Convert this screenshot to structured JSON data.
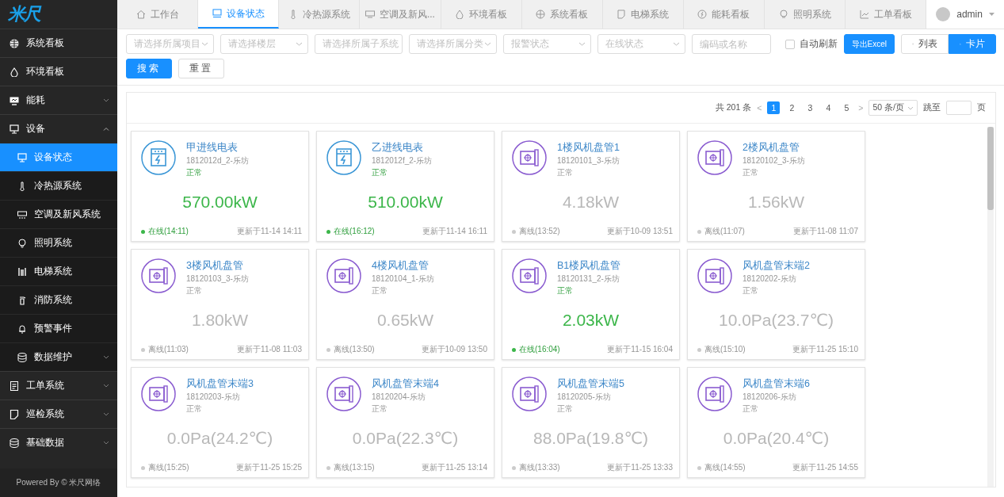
{
  "logo": "米尺",
  "sidebar": {
    "items": [
      {
        "label": "系统看板",
        "kind": "link",
        "selected": false
      },
      {
        "label": "环境看板",
        "kind": "link",
        "selected": false
      },
      {
        "label": "能耗",
        "kind": "group",
        "expanded": false
      },
      {
        "label": "设备",
        "kind": "group",
        "expanded": true,
        "children": [
          {
            "label": "设备状态",
            "kind": "link",
            "selected": true
          },
          {
            "label": "冷热源系统",
            "kind": "link",
            "selected": false
          },
          {
            "label": "空调及新风系统",
            "kind": "link",
            "selected": false
          },
          {
            "label": "照明系统",
            "kind": "link",
            "selected": false
          },
          {
            "label": "电梯系统",
            "kind": "link",
            "selected": false
          },
          {
            "label": "消防系统",
            "kind": "link",
            "selected": false
          },
          {
            "label": "预警事件",
            "kind": "link",
            "selected": false
          },
          {
            "label": "数据维护",
            "kind": "group",
            "expanded": false
          }
        ]
      },
      {
        "label": "工单系统",
        "kind": "group",
        "expanded": false
      },
      {
        "label": "巡检系统",
        "kind": "group",
        "expanded": false
      },
      {
        "label": "基础数据",
        "kind": "group",
        "expanded": false
      }
    ],
    "footer": "Powered By © 米尺网络"
  },
  "tabs": [
    {
      "label": "工作台",
      "selected": false
    },
    {
      "label": "设备状态",
      "selected": true
    },
    {
      "label": "冷热源系统",
      "selected": false
    },
    {
      "label": "空调及新风...",
      "selected": false
    },
    {
      "label": "环境看板",
      "selected": false
    },
    {
      "label": "系统看板",
      "selected": false
    },
    {
      "label": "电梯系统",
      "selected": false
    },
    {
      "label": "能耗看板",
      "selected": false
    },
    {
      "label": "照明系统",
      "selected": false
    },
    {
      "label": "工单看板",
      "selected": false
    }
  ],
  "user": {
    "name": "admin"
  },
  "filters": {
    "selects": [
      {
        "placeholder": "请选择所属项目"
      },
      {
        "placeholder": "请选择楼层"
      },
      {
        "placeholder": "请选择所属子系统"
      },
      {
        "placeholder": "请选择所属分类"
      },
      {
        "placeholder": "报警状态"
      },
      {
        "placeholder": "在线状态"
      }
    ],
    "search": {
      "placeholder": "编码或名称"
    },
    "auto_refresh": {
      "label": "自动刷新",
      "checked": false
    },
    "export": "导出Excel",
    "views": [
      {
        "label": "列表",
        "selected": false
      },
      {
        "label": "卡片",
        "selected": true
      }
    ],
    "actions": [
      {
        "label": "搜索",
        "kind": "primary"
      },
      {
        "label": "重置",
        "kind": "default"
      }
    ]
  },
  "pagination": {
    "total": "共 201 条",
    "prev": "<",
    "next": ">",
    "pages": [
      {
        "label": "1",
        "selected": true
      },
      {
        "label": "2",
        "selected": false
      },
      {
        "label": "3",
        "selected": false
      },
      {
        "label": "4",
        "selected": false
      },
      {
        "label": "5",
        "selected": false
      }
    ],
    "page_size": "50 条/页",
    "jump_label": "跳至",
    "page_suffix": "页"
  },
  "cards": [
    {
      "kind": "meter",
      "name": "甲进线电表",
      "code": "1812012d_2-乐坊",
      "status": "正常",
      "online": true,
      "value": "570.00kW",
      "connection": "在线(14:11)",
      "updated": "更新于11-14 14:11"
    },
    {
      "kind": "meter",
      "name": "乙进线电表",
      "code": "1812012f_2-乐坊",
      "status": "正常",
      "online": true,
      "value": "510.00kW",
      "connection": "在线(16:12)",
      "updated": "更新于11-14 16:11"
    },
    {
      "kind": "fan_coil",
      "name": "1楼风机盘管1",
      "code": "18120101_3-乐坊",
      "status": "正常",
      "online": false,
      "value": "4.18kW",
      "connection": "离线(13:52)",
      "updated": "更新于10-09 13:51"
    },
    {
      "kind": "fan_coil",
      "name": "2楼风机盘管",
      "code": "18120102_3-乐坊",
      "status": "正常",
      "online": false,
      "value": "1.56kW",
      "connection": "离线(11:07)",
      "updated": "更新于11-08 11:07"
    },
    {
      "kind": "fan_coil",
      "name": "3楼风机盘管",
      "code": "18120103_3-乐坊",
      "status": "正常",
      "online": false,
      "value": "1.80kW",
      "connection": "离线(11:03)",
      "updated": "更新于11-08 11:03"
    },
    {
      "kind": "fan_coil",
      "name": "4楼风机盘管",
      "code": "18120104_1-乐坊",
      "status": "正常",
      "online": false,
      "value": "0.65kW",
      "connection": "离线(13:50)",
      "updated": "更新于10-09 13:50"
    },
    {
      "kind": "fan_coil",
      "name": "B1楼风机盘管",
      "code": "18120131_2-乐坊",
      "status": "正常",
      "online": true,
      "value": "2.03kW",
      "connection": "在线(16:04)",
      "updated": "更新于11-15 16:04"
    },
    {
      "kind": "fan_coil",
      "name": "风机盘管末端2",
      "code": "18120202-乐坊",
      "status": "正常",
      "online": false,
      "value": "10.0Pa(23.7℃)",
      "connection": "离线(15:10)",
      "updated": "更新于11-25 15:10"
    },
    {
      "kind": "fan_coil",
      "name": "风机盘管末端3",
      "code": "18120203-乐坊",
      "status": "正常",
      "online": false,
      "value": "0.0Pa(24.2℃)",
      "connection": "离线(15:25)",
      "updated": "更新于11-25 15:25"
    },
    {
      "kind": "fan_coil",
      "name": "风机盘管末端4",
      "code": "18120204-乐坊",
      "status": "正常",
      "online": false,
      "value": "0.0Pa(22.3℃)",
      "connection": "离线(13:15)",
      "updated": "更新于11-25 13:14"
    },
    {
      "kind": "fan_coil",
      "name": "风机盘管末端5",
      "code": "18120205-乐坊",
      "status": "正常",
      "online": false,
      "value": "88.0Pa(19.8℃)",
      "connection": "离线(13:33)",
      "updated": "更新于11-25 13:33"
    },
    {
      "kind": "fan_coil",
      "name": "风机盘管末端6",
      "code": "18120206-乐坊",
      "status": "正常",
      "online": false,
      "value": "0.0Pa(20.4℃)",
      "connection": "离线(14:55)",
      "updated": "更新于11-25 14:55"
    }
  ]
}
